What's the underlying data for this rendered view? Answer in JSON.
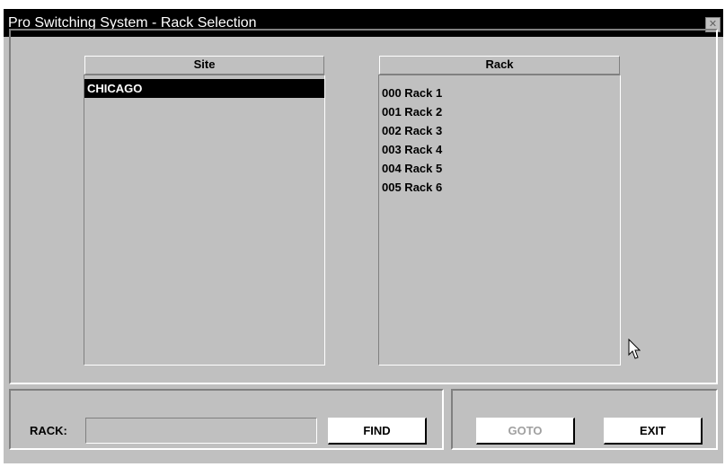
{
  "window": {
    "title": "Pro Switching System - Rack Selection",
    "close_glyph": "✕"
  },
  "site_list": {
    "header": "Site",
    "items": [
      {
        "label": "CHICAGO",
        "selected": true
      }
    ]
  },
  "rack_list": {
    "header": "Rack",
    "items": [
      {
        "label": "000 Rack 1"
      },
      {
        "label": "001 Rack 2"
      },
      {
        "label": "002 Rack 3"
      },
      {
        "label": "003 Rack 4"
      },
      {
        "label": "004 Rack 5"
      },
      {
        "label": "005 Rack 6"
      }
    ]
  },
  "bottom": {
    "rack_label": "RACK:",
    "rack_value": "",
    "find_label": "FIND",
    "goto_label": "GOTO",
    "goto_enabled": false,
    "exit_label": "EXIT"
  },
  "colors": {
    "window_bg": "#c0c0c0",
    "titlebar_bg": "#000000",
    "titlebar_text": "#ffffff",
    "selection_bg": "#000000",
    "disabled_text": "#a0a0a0"
  },
  "icons": {
    "close": "close-icon",
    "cursor": "mouse-pointer-icon"
  }
}
